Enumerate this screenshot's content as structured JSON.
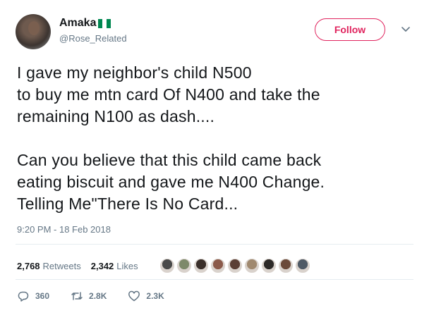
{
  "author": {
    "name": "Amaka",
    "handle": "@Rose_Related",
    "flag_colors": [
      "#008751",
      "#ffffff",
      "#008751"
    ],
    "avatar": "profile-photo"
  },
  "follow_button": {
    "label": "Follow",
    "color": "#e0245e"
  },
  "caret_icon": "chevron-down-icon",
  "tweet": {
    "para1": [
      "I gave my neighbor's child N500",
      "to buy me mtn card Of N400 and take the",
      "remaining N100 as dash...."
    ],
    "para2": [
      "Can you believe that this child came back",
      "eating biscuit and gave me N400 Change.",
      "Telling Me\"There Is No Card..."
    ],
    "timestamp": "9:20 PM - 18 Feb 2018"
  },
  "stats": {
    "retweets_count": "2,768",
    "retweets_label": "Retweets",
    "likes_count": "2,342",
    "likes_label": "Likes"
  },
  "likers": [
    "#4a4a4a",
    "#7d8a6a",
    "#3a2f2a",
    "#8b5a4a",
    "#5b3f35",
    "#a0896f",
    "#2d2a28",
    "#6b4a3a",
    "#4f5a66"
  ],
  "actions": {
    "reply_count": "360",
    "retweet_count": "2.8K",
    "like_count": "2.3K"
  }
}
